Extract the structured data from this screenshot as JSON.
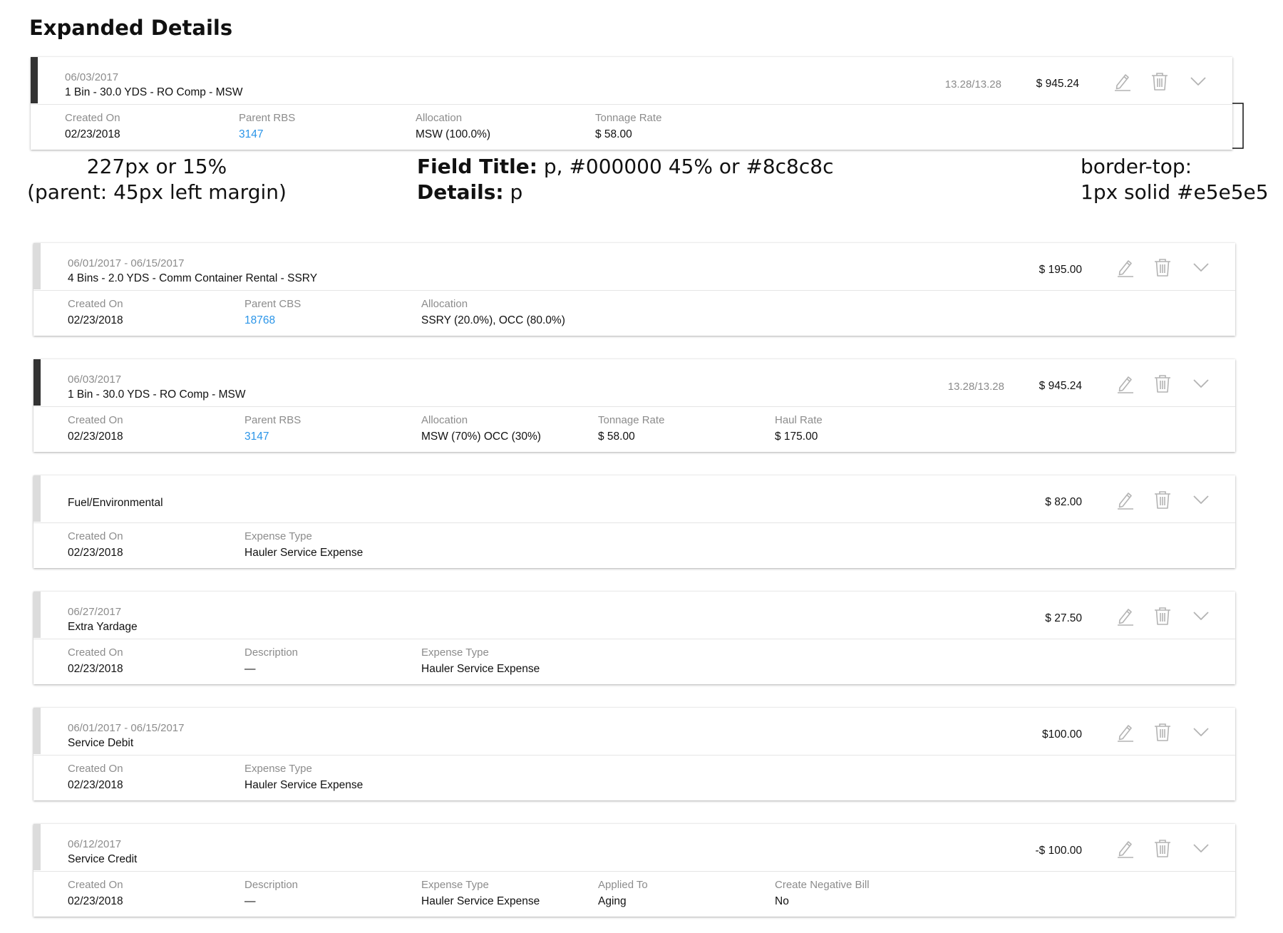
{
  "page_title": "Expanded Details",
  "annotations": {
    "width_line1": "227px or 15%",
    "width_line2": "(parent: 45px left margin)",
    "field_title_label": "Field Title:",
    "field_title_value": "p, #000000 45% or #8c8c8c",
    "details_label": "Details:",
    "details_value": "p",
    "border_line1": "border-top:",
    "border_line2": "1px solid #e5e5e5"
  },
  "colors": {
    "field_title": "#8c8c8c",
    "border": "#e5e5e5",
    "link": "#2b95e8",
    "accent_dark": "#333333",
    "accent_light": "#dcdcdc"
  },
  "icons": [
    "edit-icon",
    "trash-icon",
    "chevron-down-icon"
  ],
  "cards": [
    {
      "date": "06/03/2017",
      "title": "1 Bin - 30.0 YDS - RO Comp - MSW",
      "tonnage": "13.28/13.28",
      "amount": "$ 945.24",
      "fields": [
        {
          "label": "Created On",
          "value": "02/23/2018"
        },
        {
          "label": "Parent RBS",
          "value": "3147"
        },
        {
          "label": "Allocation",
          "value": "MSW (100.0%)"
        },
        {
          "label": "Tonnage Rate",
          "value": "$ 58.00"
        }
      ]
    },
    {
      "date": "06/01/2017 - 06/15/2017",
      "title": "4 Bins - 2.0 YDS - Comm Container Rental - SSRY",
      "amount": "$ 195.00",
      "fields": [
        {
          "label": "Created On",
          "value": "02/23/2018"
        },
        {
          "label": "Parent CBS",
          "value": "18768"
        },
        {
          "label": "Allocation",
          "value": "SSRY (20.0%), OCC (80.0%)"
        }
      ]
    },
    {
      "date": "06/03/2017",
      "title": "1 Bin - 30.0 YDS - RO Comp - MSW",
      "tonnage": "13.28/13.28",
      "amount": "$ 945.24",
      "fields": [
        {
          "label": "Created On",
          "value": "02/23/2018"
        },
        {
          "label": "Parent RBS",
          "value": "3147"
        },
        {
          "label": "Allocation",
          "value": "MSW (70%) OCC (30%)"
        },
        {
          "label": "Tonnage Rate",
          "value": "$ 58.00"
        },
        {
          "label": "Haul Rate",
          "value": "$ 175.00"
        }
      ]
    },
    {
      "title": "Fuel/Environmental",
      "amount": "$ 82.00",
      "fields": [
        {
          "label": "Created On",
          "value": "02/23/2018"
        },
        {
          "label": "Expense Type",
          "value": "Hauler Service Expense"
        }
      ]
    },
    {
      "date": "06/27/2017",
      "title": "Extra Yardage",
      "amount": "$ 27.50",
      "fields": [
        {
          "label": "Created On",
          "value": "02/23/2018"
        },
        {
          "label": "Description",
          "value": "—"
        },
        {
          "label": "Expense Type",
          "value": "Hauler Service Expense"
        }
      ]
    },
    {
      "date": "06/01/2017 - 06/15/2017",
      "title": "Service Debit",
      "amount": "$100.00",
      "fields": [
        {
          "label": "Created On",
          "value": "02/23/2018"
        },
        {
          "label": "Expense Type",
          "value": "Hauler Service Expense"
        }
      ]
    },
    {
      "date": "06/12/2017",
      "title": "Service Credit",
      "amount": "-$ 100.00",
      "fields": [
        {
          "label": "Created On",
          "value": "02/23/2018"
        },
        {
          "label": "Description",
          "value": "—"
        },
        {
          "label": "Expense Type",
          "value": "Hauler Service Expense"
        },
        {
          "label": "Applied To",
          "value": "Aging"
        },
        {
          "label": "Create Negative Bill",
          "value": "No"
        }
      ]
    }
  ]
}
